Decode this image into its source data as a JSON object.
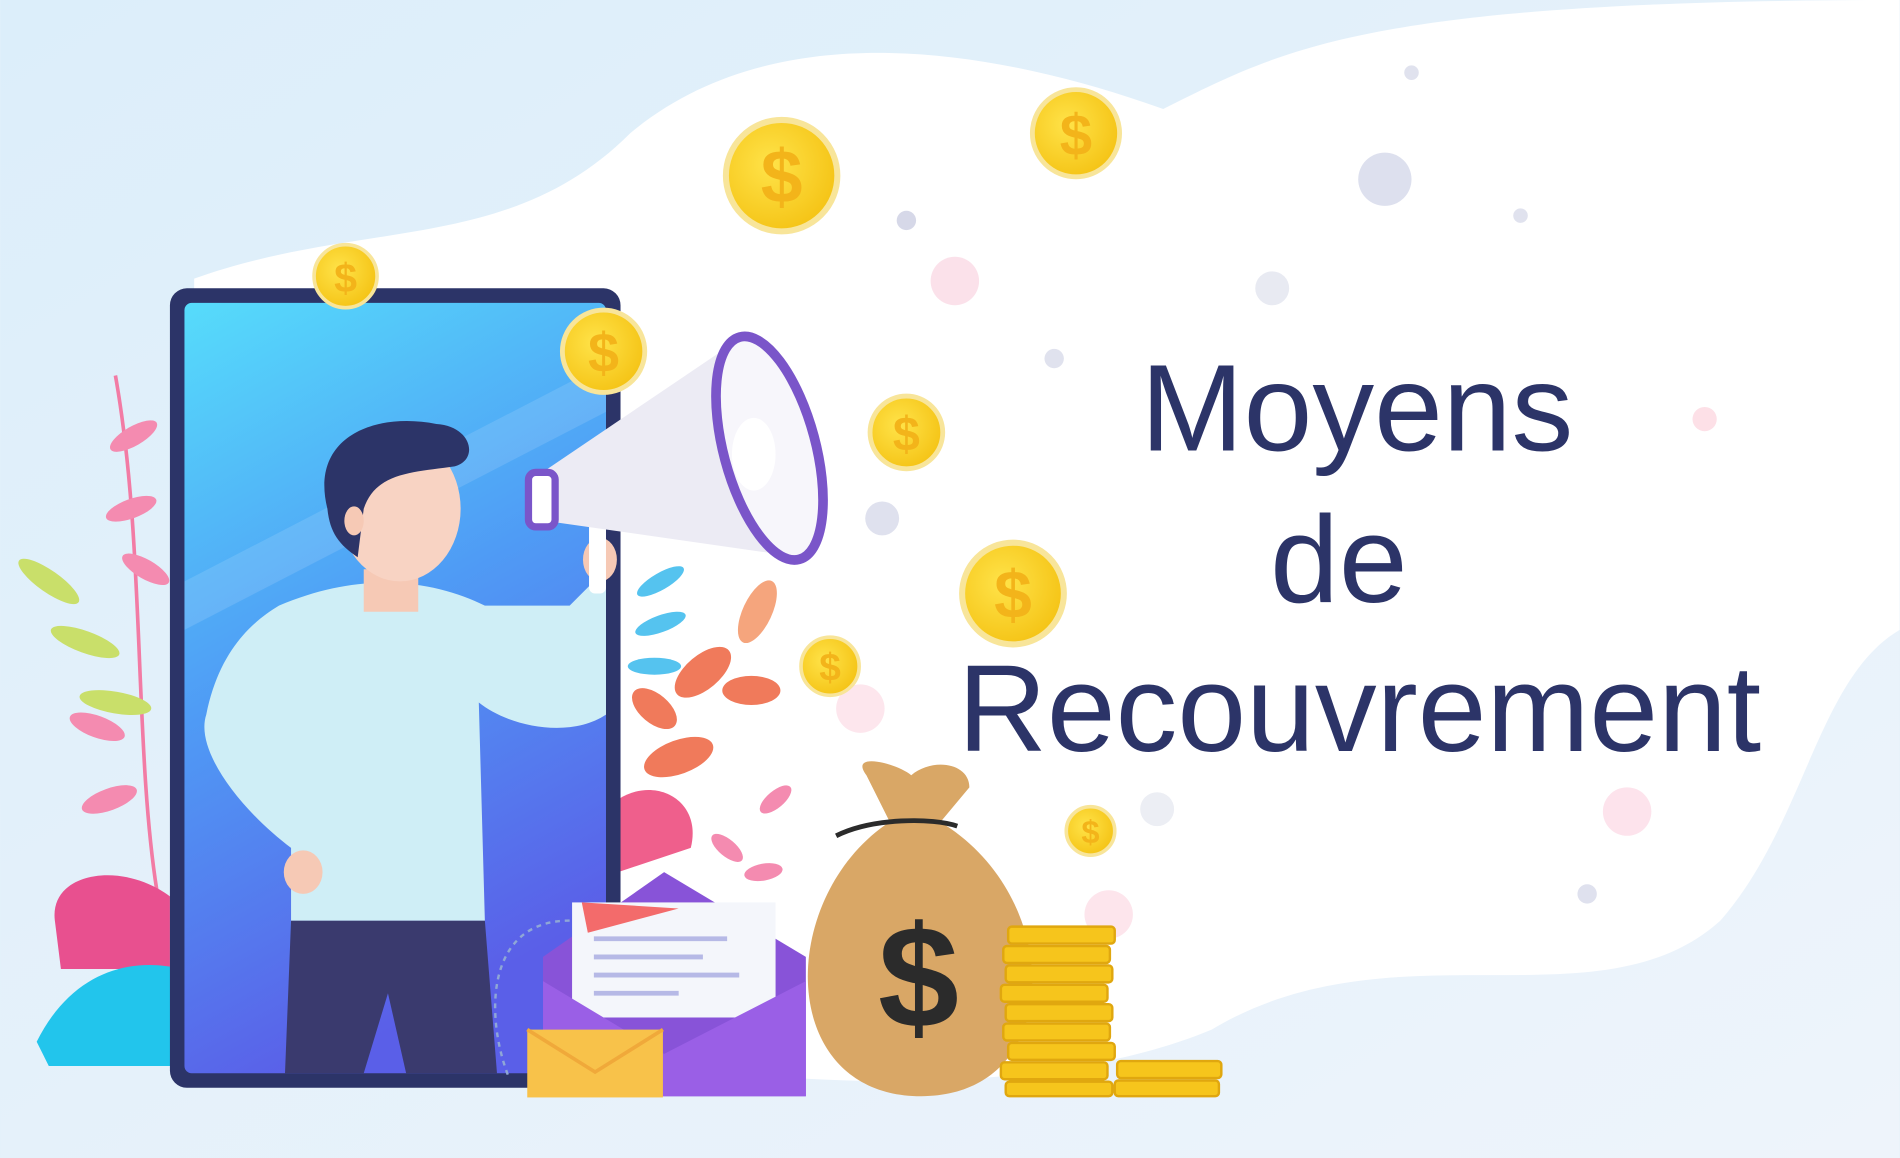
{
  "title": {
    "line1": "Moyens",
    "line2": "de",
    "line3": "Recouvrement"
  },
  "currency_symbol": "$",
  "colors": {
    "title": "#2c3468",
    "background": "#e3f1fa",
    "coin": "#fbd531",
    "phone_screen": "#4f9bf5"
  }
}
